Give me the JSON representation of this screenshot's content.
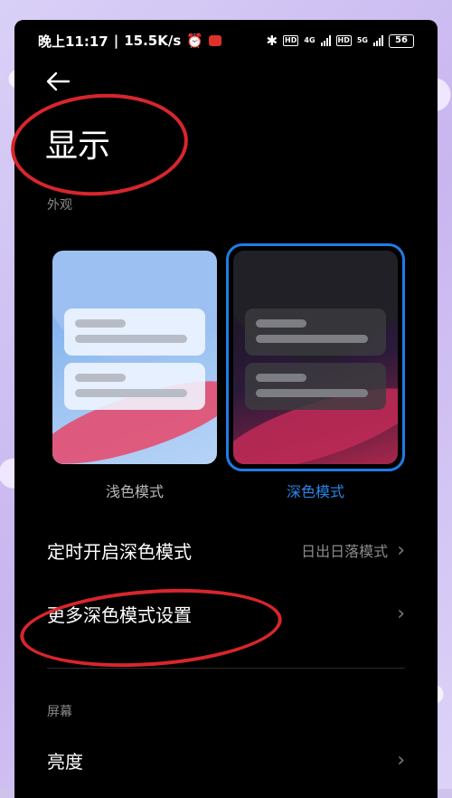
{
  "status_bar": {
    "time": "晚上11:17",
    "speed": "15.5K/s",
    "battery": "56",
    "net_4g": "4G",
    "net_5g": "5G"
  },
  "page": {
    "title": "显示"
  },
  "appearance": {
    "section_label": "外观",
    "modes": [
      {
        "label": "浅色模式",
        "selected": false
      },
      {
        "label": "深色模式",
        "selected": true
      }
    ],
    "accent_color": "#1f7ce6"
  },
  "settings_rows": [
    {
      "label": "定时开启深色模式",
      "value": "日出日落模式"
    },
    {
      "label": "更多深色模式设置",
      "value": ""
    }
  ],
  "screen_section": {
    "section_label": "屏幕",
    "rows": [
      {
        "label": "亮度"
      }
    ]
  },
  "annotation_color": "#d8262b"
}
